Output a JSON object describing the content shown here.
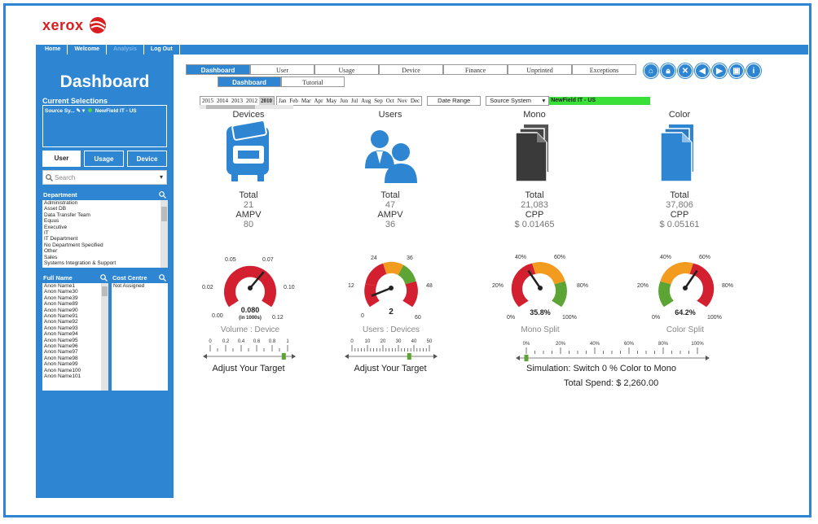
{
  "brand": {
    "name": "xerox"
  },
  "top_nav": [
    "Home",
    "Welcome",
    "Analysis",
    "Log Out"
  ],
  "sidebar": {
    "title": "Dashboard",
    "current_selections_label": "Current Selections",
    "selection_field": "Source Sy...",
    "selection_value": "NewField IT - US",
    "buttons": [
      "User",
      "Usage",
      "Device"
    ],
    "search_placeholder": "Search",
    "department_label": "Department",
    "departments": [
      "Administration",
      "Asset DB",
      "Data Transfer Team",
      "Equus",
      "Executive",
      "IT",
      "IT Department",
      "No Department Specified",
      "Other",
      "Sales",
      "Systems Integration & Support"
    ],
    "full_name_label": "Full Name",
    "names": [
      "Anon Name1",
      "Anon Name30",
      "Anon Name39",
      "Anon Name89",
      "Anon Name90",
      "Anon Name91",
      "Anon Name92",
      "Anon Name93",
      "Anon Name94",
      "Anon Name95",
      "Anon Name96",
      "Anon Name97",
      "Anon Name98",
      "Anon Name99",
      "Anon Name100",
      "Anon Name101"
    ],
    "cost_centre_label": "Cost Centre",
    "cost_centres": [
      "Not Assigned"
    ]
  },
  "tabs": [
    "Dashboard",
    "User",
    "Usage",
    "Device",
    "Finance",
    "Unprinted",
    "Exceptions"
  ],
  "subtabs": [
    "Dashboard",
    "Tutorial"
  ],
  "icons": [
    "home-icon",
    "lock-icon",
    "close-icon",
    "back-icon",
    "forward-icon",
    "save-icon",
    "info-icon"
  ],
  "filters": {
    "years": [
      "2015",
      "2014",
      "2013",
      "2012",
      "2010"
    ],
    "selected_year": "2010",
    "months": [
      "Jan",
      "Feb",
      "Mar",
      "Apr",
      "May",
      "Jun",
      "Jul",
      "Aug",
      "Sep",
      "Oct",
      "Nov",
      "Dec"
    ],
    "date_range_label": "Date Range",
    "source_system_label": "Source System",
    "source_system_value": "NewField IT - US"
  },
  "panels": [
    {
      "title": "Devices",
      "total_label": "Total",
      "total_value": "21",
      "metric_label": "AMPV",
      "metric_value": "80"
    },
    {
      "title": "Users",
      "total_label": "Total",
      "total_value": "47",
      "metric_label": "AMPV",
      "metric_value": "36"
    },
    {
      "title": "Mono",
      "total_label": "Total",
      "total_value": "21,083",
      "metric_label": "CPP",
      "metric_value": "$ 0.01465"
    },
    {
      "title": "Color",
      "total_label": "Total",
      "total_value": "37,806",
      "metric_label": "CPP",
      "metric_value": "$ 0.05161"
    }
  ],
  "gauges": [
    {
      "label": "Volume : Device",
      "value_text": "0.080",
      "unit_text": "(in 1000s)",
      "ticks": [
        "0.00",
        "0.02",
        "0.05",
        "0.07",
        "0.10",
        "0.12"
      ],
      "value": 0.08,
      "min": 0,
      "max": 0.12
    },
    {
      "label": "Users : Devices",
      "value_text": "2",
      "unit_text": "",
      "ticks": [
        "0",
        "12",
        "24",
        "36",
        "48",
        "60"
      ],
      "value": 2,
      "min": 0,
      "max": 60
    },
    {
      "label": "Mono Split",
      "value_text": "35.8%",
      "unit_text": "",
      "ticks": [
        "0%",
        "20%",
        "40%",
        "60%",
        "80%",
        "100%"
      ],
      "value": 35.8,
      "min": 0,
      "max": 100
    },
    {
      "label": "Color Split",
      "value_text": "64.2%",
      "unit_text": "",
      "ticks": [
        "0%",
        "20%",
        "40%",
        "60%",
        "80%",
        "100%"
      ],
      "value": 64.2,
      "min": 0,
      "max": 100
    }
  ],
  "sliders": [
    {
      "ticks": [
        "0",
        "0.2",
        "0.4",
        "0.6",
        "0.8",
        "1"
      ],
      "label": "Adjust Your Target",
      "value_fraction": 0.95
    },
    {
      "ticks": [
        "0",
        "10",
        "20",
        "30",
        "40",
        "50"
      ],
      "label": "Adjust Your Target",
      "value_fraction": 0.74
    },
    {
      "ticks": [
        "0%",
        "20%",
        "40%",
        "60%",
        "80%",
        "100%"
      ],
      "label": "Simulation: Switch 0 % Color to Mono",
      "value_fraction": 0.0
    }
  ],
  "total_spend": "Total Spend: $ 2,260.00",
  "colors": {
    "accent": "#2e86d2",
    "red": "#d32030",
    "orange": "#f39b1e",
    "green": "#5ca534",
    "chip": "#38e038"
  }
}
